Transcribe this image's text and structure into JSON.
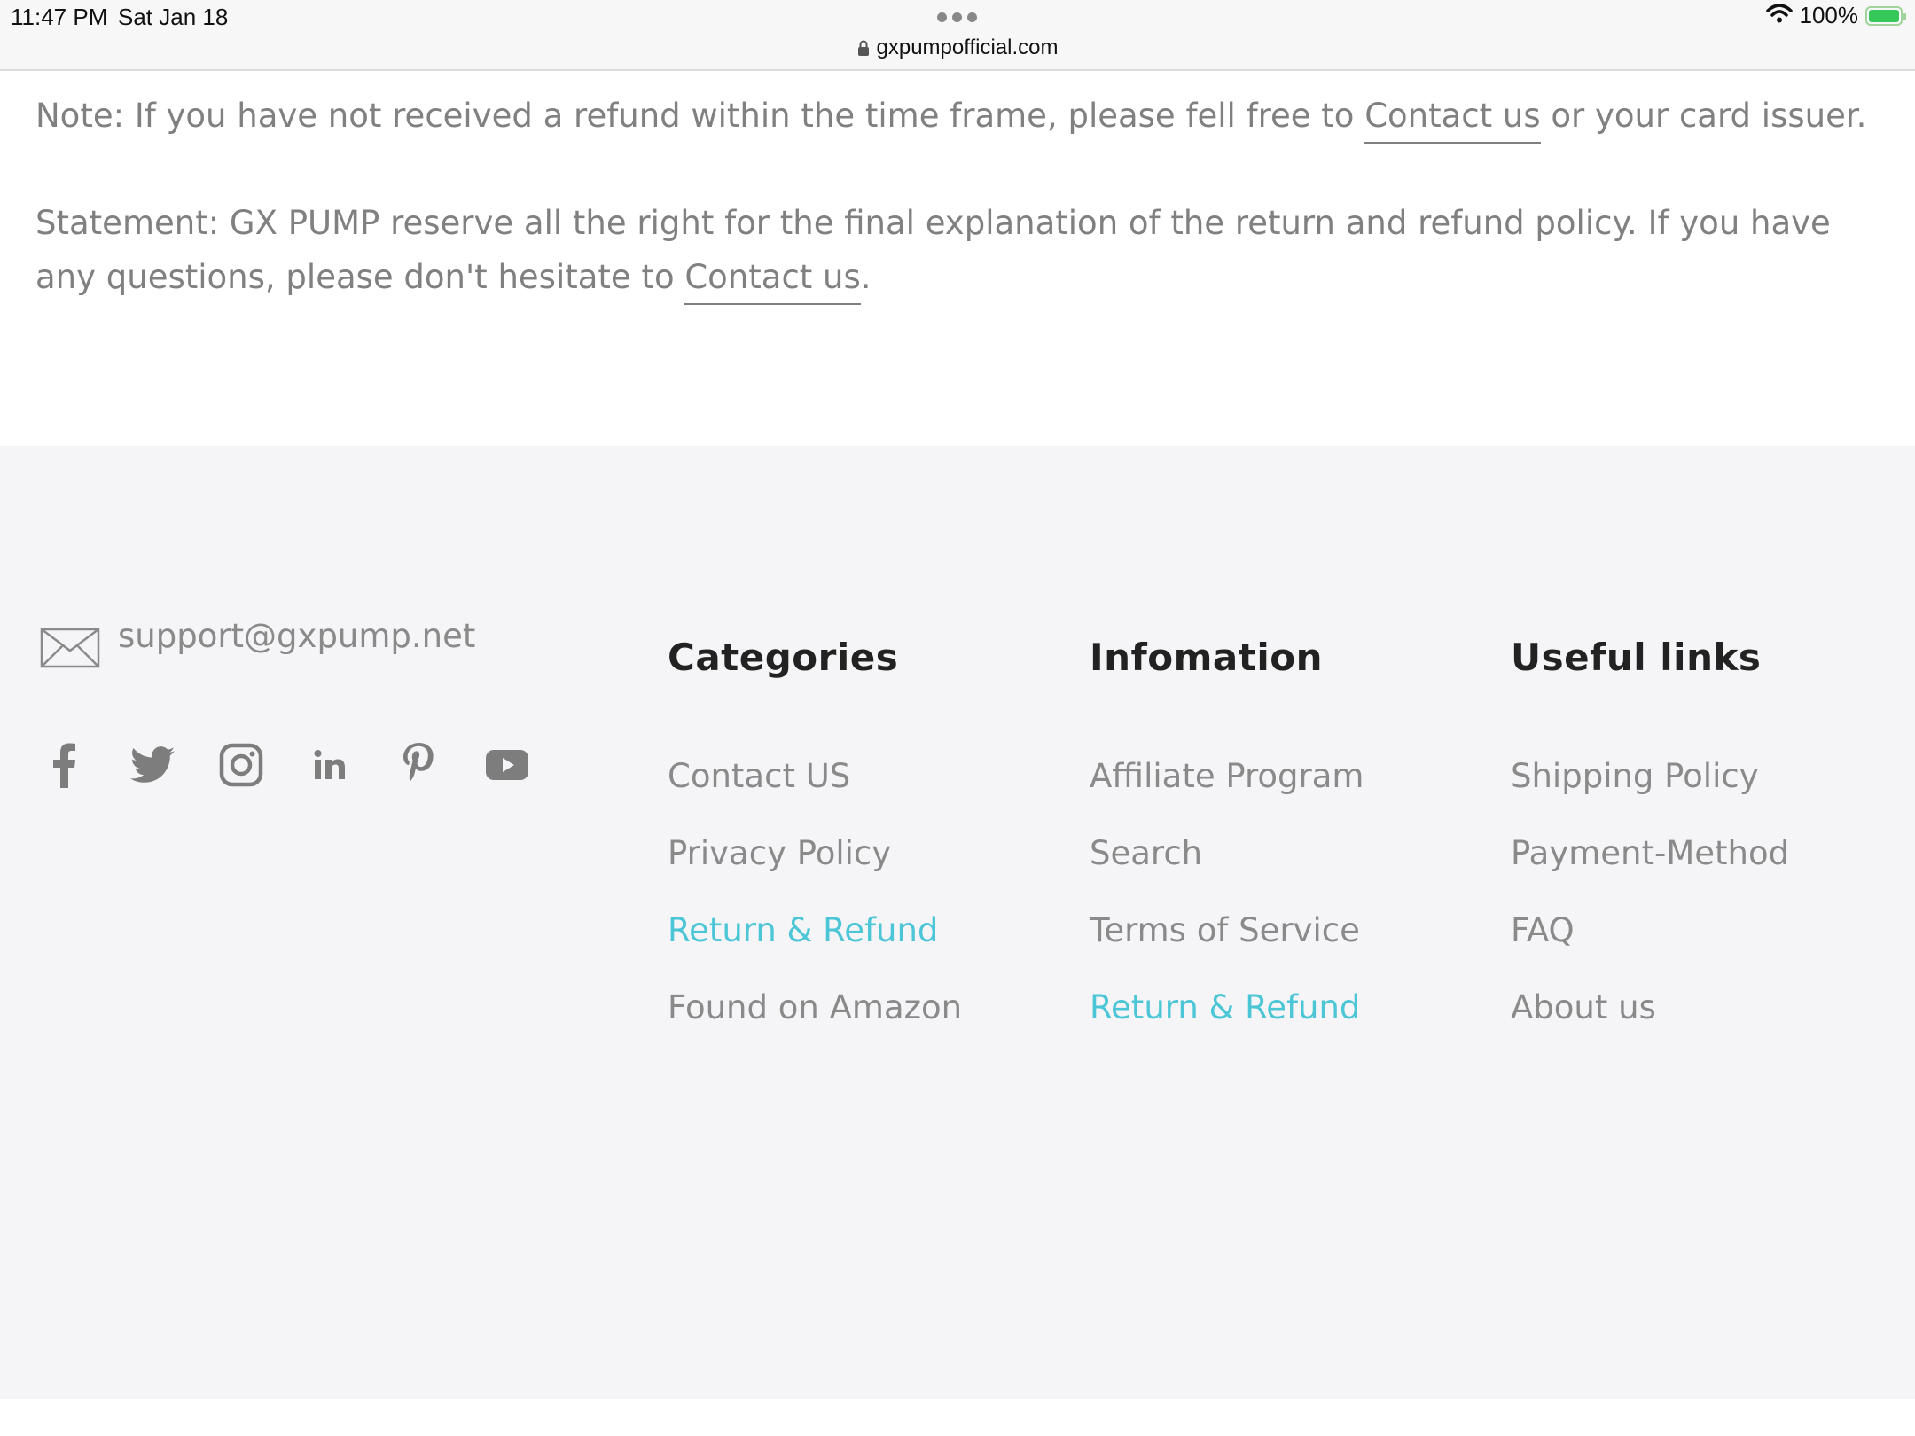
{
  "status_bar": {
    "time": "11:47 PM",
    "date": "Sat Jan 18",
    "url": "gxpumpofficial.com",
    "battery": "100%"
  },
  "content": {
    "note_before": "Note: If you have not received a refund within the time frame, please fell free to ",
    "note_link": "Contact us",
    "note_after": " or your card issuer.",
    "statement_before": "Statement: GX PUMP reserve all the right for the final explanation of the return and refund policy. If you have any questions, please don't hesitate to ",
    "statement_link": "Contact us",
    "statement_after": "."
  },
  "footer": {
    "email": "support@gxpump.net",
    "social_icons": [
      "facebook-icon",
      "twitter-icon",
      "instagram-icon",
      "linkedin-icon",
      "pinterest-icon",
      "youtube-icon"
    ],
    "columns": [
      {
        "title": "Categories",
        "items": [
          {
            "label": "Contact US",
            "active": false
          },
          {
            "label": "Privacy Policy",
            "active": false
          },
          {
            "label": "Return & Refund",
            "active": true
          },
          {
            "label": "Found on Amazon",
            "active": false
          }
        ]
      },
      {
        "title": "Infomation",
        "items": [
          {
            "label": "Affiliate Program",
            "active": false
          },
          {
            "label": "Search",
            "active": false
          },
          {
            "label": "Terms of Service",
            "active": false
          },
          {
            "label": "Return & Refund",
            "active": true
          }
        ]
      },
      {
        "title": "Useful links",
        "items": [
          {
            "label": "Shipping Policy",
            "active": false
          },
          {
            "label": "Payment-Method",
            "active": false
          },
          {
            "label": "FAQ",
            "active": false
          },
          {
            "label": "About us",
            "active": false
          }
        ]
      }
    ]
  },
  "colors": {
    "active_link": "#4cc6d6",
    "text_gray": "#808080",
    "footer_bg": "#f5f5f7",
    "heading": "#222222"
  }
}
